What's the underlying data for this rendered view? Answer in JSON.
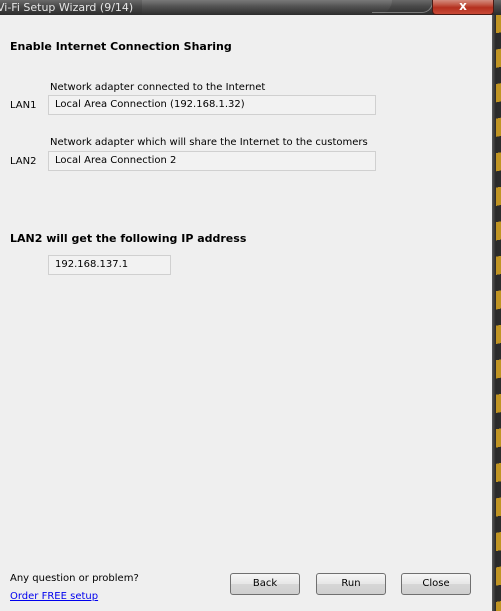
{
  "window": {
    "title": "Vi-Fi Setup Wizard (9/14)",
    "close_glyph": "x"
  },
  "section1": {
    "heading": "Enable Internet Connection Sharing",
    "lan1": {
      "caption": "Network adapter connected to the Internet",
      "label": "LAN1",
      "value": "Local Area Connection (192.168.1.32)"
    },
    "lan2": {
      "caption": "Network adapter which will share the Internet to the customers",
      "label": "LAN2",
      "value": "Local Area Connection 2"
    }
  },
  "section2": {
    "heading": "LAN2 will get the following IP address",
    "ip": "192.168.137.1"
  },
  "footer": {
    "help_text": "Any question or problem?",
    "help_link": "Order FREE setup",
    "back_label": "Back",
    "run_label": "Run",
    "close_label": "Close"
  },
  "colors": {
    "link": "#0000ee",
    "title_text": "#e6e6e6",
    "close_button": "#c45b49",
    "background": "#efefef"
  }
}
